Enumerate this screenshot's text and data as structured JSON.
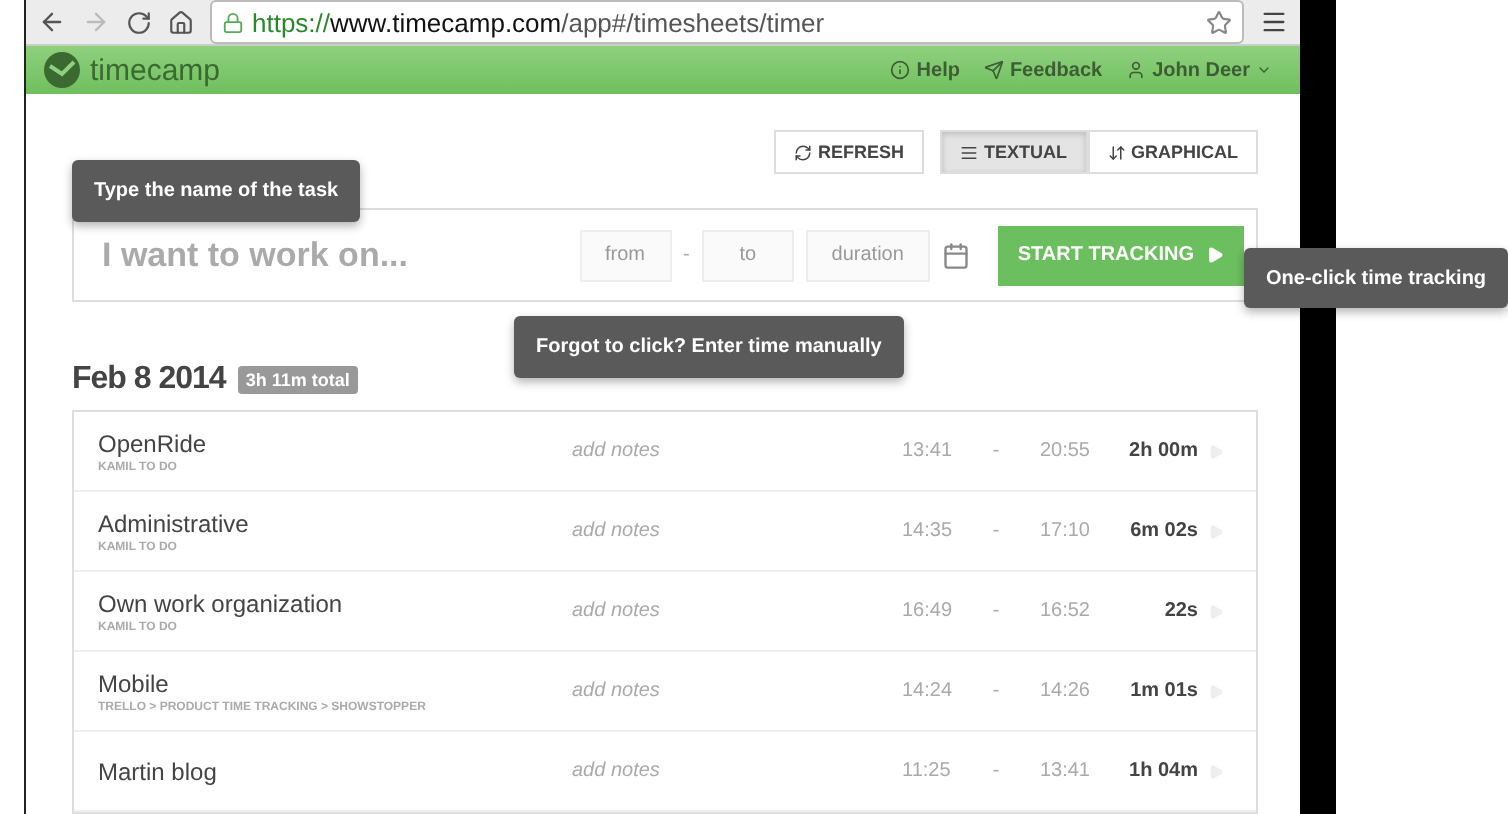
{
  "browser": {
    "url_scheme": "https://",
    "url_host": "www.timecamp.com",
    "url_path": "/app#/timesheets/timer"
  },
  "header": {
    "logo": "timecamp",
    "links": [
      {
        "label": "Help",
        "kind": "help"
      },
      {
        "label": "Feedback",
        "kind": "feedback"
      },
      {
        "label": "John Deer",
        "kind": "user"
      }
    ]
  },
  "view_buttons": [
    {
      "label": "REFRESH",
      "kind": "refresh",
      "selected": false
    },
    {
      "label": "TEXTUAL",
      "kind": "textual",
      "selected": true
    },
    {
      "label": "GRAPHICAL",
      "kind": "graphical",
      "selected": false
    }
  ],
  "task_tooltip": "Type the name of the task",
  "entry": {
    "task_placeholder": "I want to work on...",
    "from_placeholder": "from",
    "separator": "-",
    "to_placeholder": "to",
    "duration_placeholder": "duration",
    "start_button": "START TRACKING"
  },
  "manual_tooltip": "Forgot to click? Enter time manually",
  "start_tooltip": "One-click time tracking",
  "day": {
    "date": "Feb 8 2014",
    "total": "3h 11m total"
  },
  "entries": [
    {
      "task": "OpenRide",
      "project": "KAMIL TO DO",
      "notes": "add notes",
      "from": "13:41",
      "sep": "-",
      "to": "20:55",
      "duration": "2h 00m"
    },
    {
      "task": "Administrative",
      "project": "KAMIL TO DO",
      "notes": "add notes",
      "from": "14:35",
      "sep": "-",
      "to": "17:10",
      "duration": "6m 02s"
    },
    {
      "task": "Own work organization",
      "project": "KAMIL TO DO",
      "notes": "add notes",
      "from": "16:49",
      "sep": "-",
      "to": "16:52",
      "duration": "22s"
    },
    {
      "task": "Mobile",
      "project": "TRELLO > PRODUCT TIME TRACKING > SHOWSTOPPER",
      "notes": "add notes",
      "from": "14:24",
      "sep": "-",
      "to": "14:26",
      "duration": "1m 01s"
    },
    {
      "task": "Martin blog",
      "notes": "add notes",
      "from": "11:25",
      "sep": "-",
      "to": "13:41",
      "duration": "1h 04m"
    }
  ]
}
